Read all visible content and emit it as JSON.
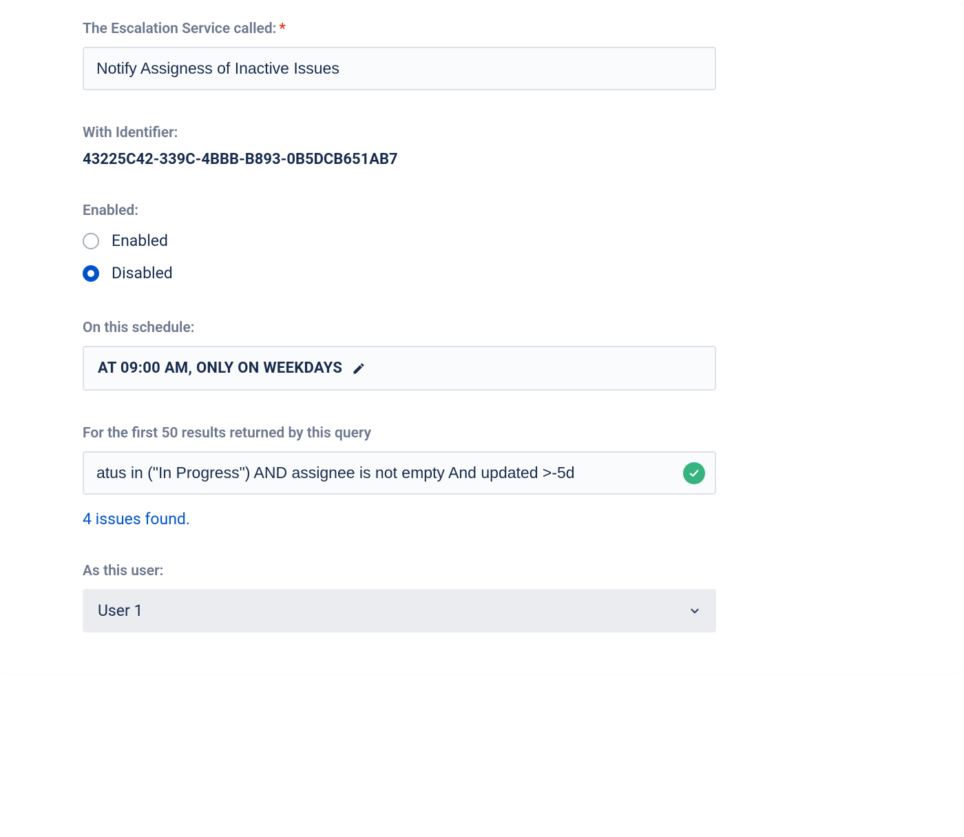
{
  "service_name": {
    "label": "The Escalation Service called:",
    "value": "Notify Assigness of Inactive Issues"
  },
  "identifier": {
    "label": "With Identifier:",
    "value": "43225C42-339C-4BBB-B893-0B5DCB651AB7"
  },
  "enabled": {
    "label": "Enabled:",
    "option_enabled": "Enabled",
    "option_disabled": "Disabled",
    "selected": "disabled"
  },
  "schedule": {
    "label": "On this schedule:",
    "value": "AT 09:00 AM, ONLY ON WEEKDAYS"
  },
  "query": {
    "label": "For the first 50 results returned by this query",
    "value": "atus in (\"In Progress\") AND assignee is not empty And updated >-5d",
    "result": "4 issues found."
  },
  "user": {
    "label": "As this user:",
    "value": "User 1"
  }
}
